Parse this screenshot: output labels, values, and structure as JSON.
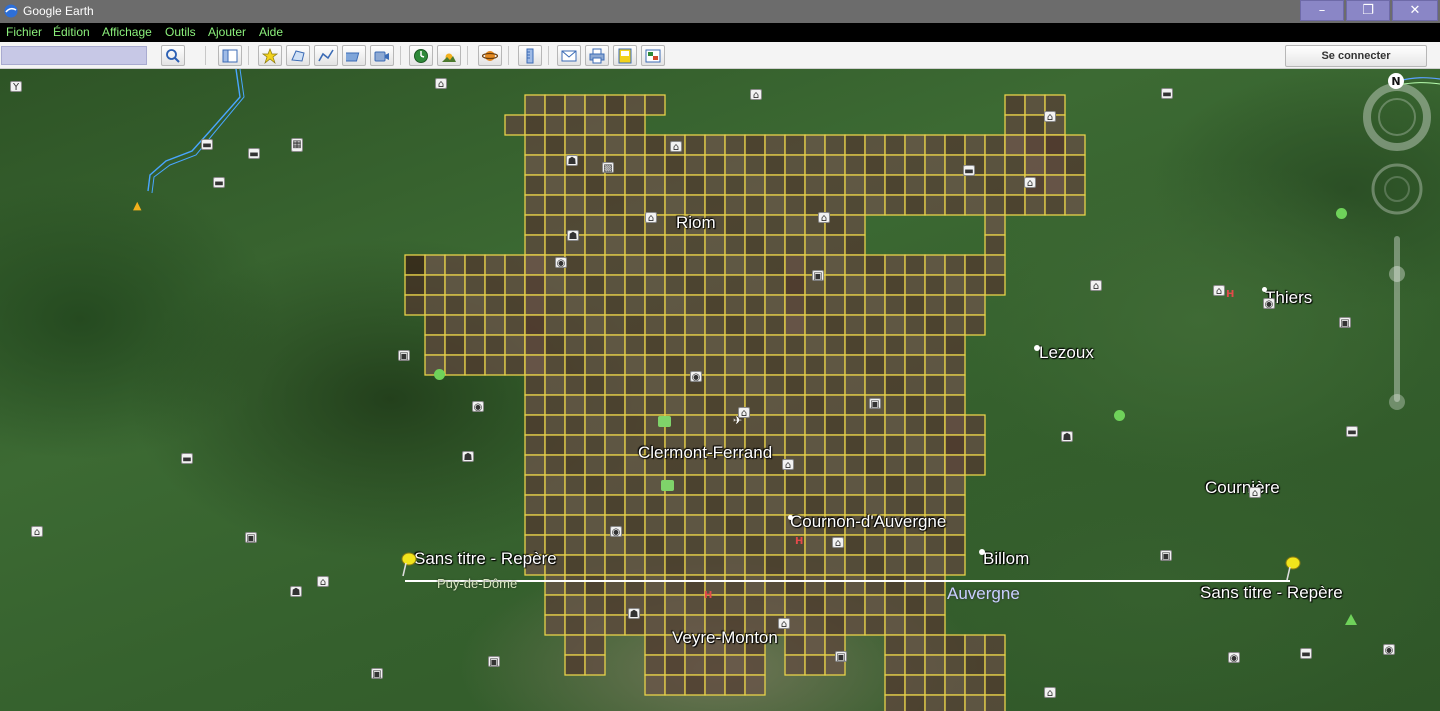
{
  "window": {
    "title": "Google Earth",
    "minimize_glyph": "–",
    "restore_glyph": "❐",
    "close_glyph": "✕"
  },
  "menu": {
    "items": [
      "Fichier",
      "Édition",
      "Affichage",
      "Outils",
      "Ajouter",
      "Aide"
    ]
  },
  "toolbar": {
    "search_value": "",
    "sign_in_label": "Se connecter",
    "icons": [
      "search-icon",
      "sidebar-toggle-icon",
      "placemark-icon",
      "polygon-icon",
      "path-icon",
      "image-overlay-icon",
      "record-tour-icon",
      "historical-imagery-icon",
      "sunlight-icon",
      "planets-icon",
      "ruler-icon",
      "email-icon",
      "print-icon",
      "save-image-icon",
      "view-in-maps-icon"
    ]
  },
  "map": {
    "places": [
      {
        "name": "Riom"
      },
      {
        "name": "Thiers"
      },
      {
        "name": "Lezoux"
      },
      {
        "name": "Clermont-Ferrand"
      },
      {
        "name": "Cournière"
      },
      {
        "name": "Cournon-d'Auvergne"
      },
      {
        "name": "Billom"
      },
      {
        "name": "Veyre-Monton"
      }
    ],
    "placemarks": [
      {
        "name": "Sans titre - Repère"
      },
      {
        "name": "Sans titre - Repère"
      }
    ],
    "region_label": "Auvergne",
    "department_label": "Puy-de-Dôme",
    "compass_letter": "N",
    "overlay_color": "#e8d24a",
    "measure_line_color": "#ffffff",
    "pin_color": "#f2e51c"
  }
}
